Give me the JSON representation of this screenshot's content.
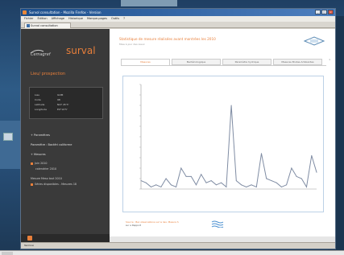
{
  "window": {
    "title": "Survol consultation - Mozilla Firefox - Version",
    "tab_label": "Survol consultation"
  },
  "menubar": [
    "Fichier",
    "Édition",
    "Affichage",
    "Historique",
    "Marque-pages",
    "Outils",
    "?"
  ],
  "sidebar": {
    "logo_text": "Cemagref",
    "brand": "surval",
    "heading": "Lieu/ prospection",
    "info": [
      {
        "k": "Lieu",
        "v": "ILOM"
      },
      {
        "k": "Code",
        "v": "98"
      },
      {
        "k": "Latitude",
        "v": "N47 45'3'"
      },
      {
        "k": "Longitude",
        "v": "E0°10'5'"
      }
    ],
    "sections": [
      {
        "label": "+ Paramètres"
      },
      {
        "label": "Paramètre : Bactéri coliforme"
      },
      {
        "label": "+ Mesures"
      }
    ],
    "items": [
      {
        "label": "Juin 2010"
      },
      {
        "label": "calendrier 2010"
      },
      {
        "label": "Mesure Meso tout 2010"
      },
      {
        "label": "Séries disponibles - Mesures 18"
      }
    ]
  },
  "main": {
    "title": "Statistique de mesure réalisées avant montrées les 2010",
    "subtitle": "Mise à jour des Lieux",
    "tabs": [
      "Mesures",
      "Bactériologique",
      "Paramètre hydrique",
      "Mesures Brutes Ambiantes"
    ],
    "footnote_1": "Source : Bac observations sur le lieu; Mesure S",
    "footnote_2": "sur a Rapport"
  },
  "status": {
    "text": "Terminé"
  },
  "chart_data": {
    "type": "line",
    "x": [
      0,
      1,
      2,
      3,
      4,
      5,
      6,
      7,
      8,
      9,
      10,
      11,
      12,
      13,
      14,
      15,
      16,
      17,
      18,
      19,
      20,
      21,
      22,
      23,
      24,
      25,
      26,
      27,
      28,
      29,
      30,
      31,
      32,
      33,
      34,
      35
    ],
    "series": [
      {
        "values": [
          4,
          3,
          1,
          2,
          1,
          5,
          2,
          1,
          10,
          6,
          6,
          2,
          7,
          3,
          4,
          2,
          3,
          1,
          40,
          4,
          2,
          1,
          2,
          1,
          17,
          5,
          4,
          3,
          1,
          2,
          10,
          6,
          5,
          1,
          16,
          8
        ]
      }
    ],
    "ylim": [
      0,
      50
    ],
    "grid": false,
    "colors": {
      "line": "#7f8ca3"
    }
  }
}
